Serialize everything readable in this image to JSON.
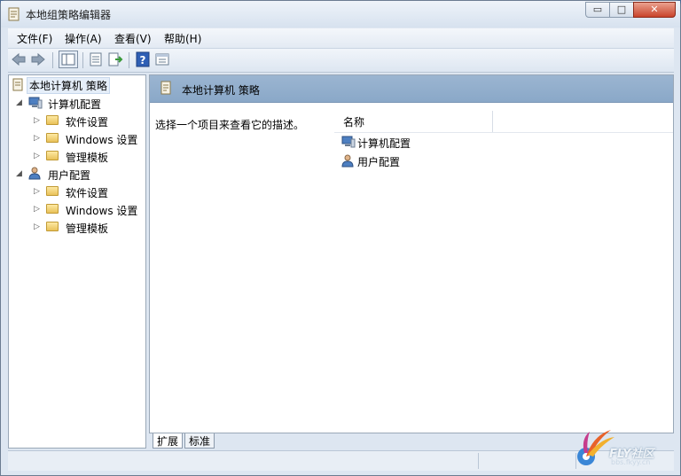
{
  "window": {
    "title": "本地组策略编辑器"
  },
  "title_controls": {
    "minimize": "▭",
    "maximize": "□",
    "close": "✕"
  },
  "menu": [
    "文件(F)",
    "操作(A)",
    "查看(V)",
    "帮助(H)"
  ],
  "tree": {
    "root": "本地计算机 策略",
    "nodes": [
      {
        "label": "计算机配置",
        "children": [
          "软件设置",
          "Windows 设置",
          "管理模板"
        ]
      },
      {
        "label": "用户配置",
        "children": [
          "软件设置",
          "Windows 设置",
          "管理模板"
        ]
      }
    ]
  },
  "right_pane": {
    "header": "本地计算机 策略",
    "description": "选择一个项目来查看它的描述。",
    "column": "名称",
    "items": [
      "计算机配置",
      "用户配置"
    ]
  },
  "tabs": [
    "扩展",
    "标准"
  ],
  "watermark": {
    "text": "FLY社区",
    "subtext": "bbs.fkyy.cn"
  },
  "colors": {
    "header": "#8aa8c8",
    "chrome": "#dde6f1"
  }
}
